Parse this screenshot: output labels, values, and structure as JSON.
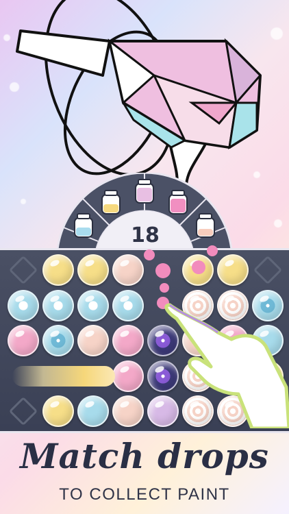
{
  "drop_counter": "18",
  "caption": {
    "title": "Match drops",
    "subtitle": "TO COLLECT PAINT"
  },
  "colors": {
    "yellow": "#f6de88",
    "blue": "#a7dbeb",
    "pink": "#f3a8c8",
    "peach": "#f6d3c7",
    "lavender": "#d7b9e6",
    "board": "#444a5e"
  },
  "paint_jars": [
    "light-blue",
    "yellow",
    "lavender",
    "pink",
    "peach"
  ],
  "board": {
    "rows": [
      [
        "slot",
        "yellow",
        "yellow",
        "peach",
        "pink-drop",
        "yellow",
        "yellow",
        "slot"
      ],
      [
        "blue-star",
        "blue-star",
        "blue-star",
        "blue-star",
        "pink-drop",
        "peach-swirl",
        "peach-swirl",
        "blue-vortex"
      ],
      [
        "pink",
        "blue-vortex",
        "peach",
        "pink",
        "purple-vortex",
        "peach",
        "pink",
        "blue"
      ],
      [
        "burst",
        "burst",
        "burst",
        "pink",
        "purple-vortex",
        "peach-swirl",
        "yellow",
        "yellow"
      ],
      [
        "slot",
        "yellow",
        "blue",
        "peach",
        "lavender",
        "peach-swirl",
        "peach-swirl",
        "slot"
      ]
    ]
  }
}
